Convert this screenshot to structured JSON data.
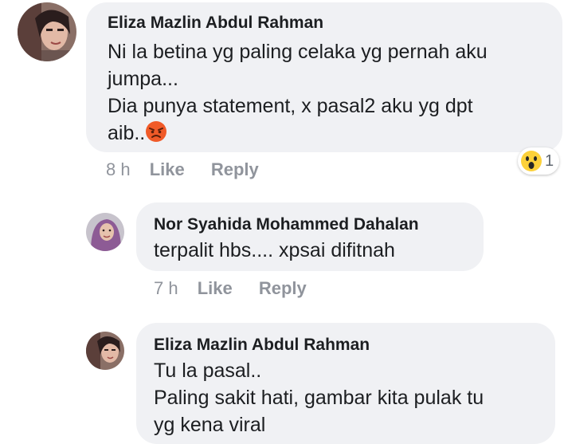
{
  "comments": [
    {
      "author": "Eliza Mazlin Abdul Rahman",
      "lines": [
        "Ni la betina yg paling celaka yg pernah aku",
        "jumpa...",
        "Dia punya statement, x pasal2 aku yg dpt",
        "aib.."
      ],
      "trailing_emoji": "angry-face-icon",
      "time": "8 h",
      "like_label": "Like",
      "reply_label": "Reply",
      "reaction": {
        "icon": "wow-reaction-icon",
        "count": "1"
      }
    },
    {
      "author": "Nor Syahida Mohammed Dahalan",
      "lines": [
        "terpalit hbs.... xpsai difitnah"
      ],
      "time": "7 h",
      "like_label": "Like",
      "reply_label": "Reply"
    },
    {
      "author": "Eliza Mazlin Abdul Rahman",
      "lines": [
        "Tu la pasal..",
        "Paling sakit hati, gambar kita pulak tu",
        "yg kena viral"
      ]
    }
  ],
  "colors": {
    "bubble": "#f0f1f4",
    "text": "#1c1e21",
    "meta": "#90949c",
    "angry": "#f05a28",
    "wow": "#fcd13a"
  }
}
